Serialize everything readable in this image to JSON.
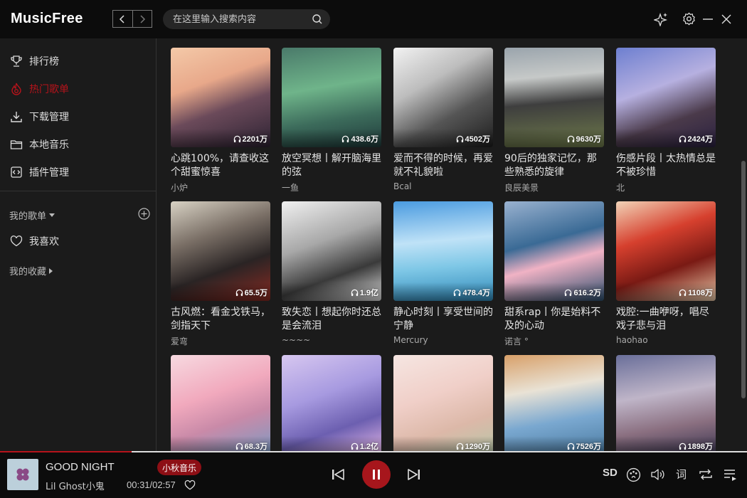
{
  "app": {
    "title": "MusicFree"
  },
  "header": {
    "back_label": "<",
    "forward_label": ">",
    "search_placeholder": "在这里输入搜索内容",
    "icons": [
      "back-icon",
      "forward-icon",
      "search-icon",
      "sparkle-icon",
      "gear-icon",
      "minimize-icon",
      "close-icon"
    ]
  },
  "sidebar": {
    "items": [
      {
        "label": "排行榜",
        "icon": "trophy-icon"
      },
      {
        "label": "热门歌单",
        "icon": "fire-icon",
        "active": true
      },
      {
        "label": "下载管理",
        "icon": "download-icon"
      },
      {
        "label": "本地音乐",
        "icon": "folder-icon"
      },
      {
        "label": "插件管理",
        "icon": "plugin-icon"
      }
    ],
    "my_playlists_label": "我的歌单",
    "favorites_label": "我喜欢",
    "my_collections_label": "我的收藏"
  },
  "playlists": [
    {
      "title": "心跳100%，请查收这个甜蜜惊喜",
      "author": "小炉",
      "plays": "2201万"
    },
    {
      "title": "放空冥想丨解开脑海里的弦",
      "author": "一鱼",
      "plays": "438.6万"
    },
    {
      "title": "爱而不得的时候，再爱就不礼貌啦",
      "author": "Bcal",
      "plays": "4502万"
    },
    {
      "title": "90后的独家记忆，那些熟悉的旋律",
      "author": "良辰美景",
      "plays": "9630万"
    },
    {
      "title": "伤感片段丨太热情总是不被珍惜",
      "author": "北",
      "plays": "2424万"
    },
    {
      "title": "古风燃：看金戈铁马，剑指天下",
      "author": "爱弯",
      "plays": "65.5万"
    },
    {
      "title": "致失恋丨想起你时还总是会流泪",
      "author": "~~~~",
      "plays": "1.9亿"
    },
    {
      "title": "静心时刻丨享受世间的宁静",
      "author": "Mercury",
      "plays": "478.4万"
    },
    {
      "title": "甜系rap丨你是始料不及的心动",
      "author": "诺言 °",
      "plays": "616.2万"
    },
    {
      "title": "戏腔:一曲咿呀，唱尽戏子悲与泪",
      "author": "haohao",
      "plays": "1108万"
    },
    {
      "title": "",
      "author": "",
      "plays": "68.3万"
    },
    {
      "title": "",
      "author": "",
      "plays": "1.2亿"
    },
    {
      "title": "",
      "author": "",
      "plays": "1290万"
    },
    {
      "title": "",
      "author": "",
      "plays": "7526万"
    },
    {
      "title": "",
      "author": "",
      "plays": "1898万"
    }
  ],
  "player": {
    "song": "GOOD NIGHT",
    "artist": "Lil Ghost小鬼",
    "source": "小秋音乐",
    "time": "00:31/02:57",
    "progress": 0.176,
    "quality": "SD",
    "lyric_label": "词"
  },
  "colors": {
    "accent": "#b5131b",
    "background": "#1b1b1b",
    "header": "#0c0c0c"
  }
}
